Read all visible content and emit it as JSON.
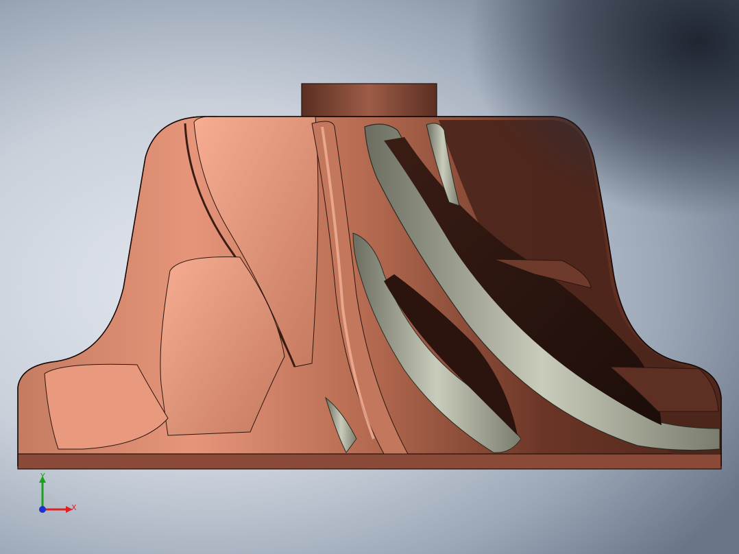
{
  "colors": {
    "body_base": "#b9735a",
    "body_light": "#f0a88c",
    "body_dark": "#5a3024",
    "blade_gray": "#b7b9a9",
    "axis_x": "#e02020",
    "axis_y": "#1aa01a",
    "axis_z": "#2030d0"
  },
  "triad": {
    "x_label": "X",
    "y_label": "Y"
  }
}
